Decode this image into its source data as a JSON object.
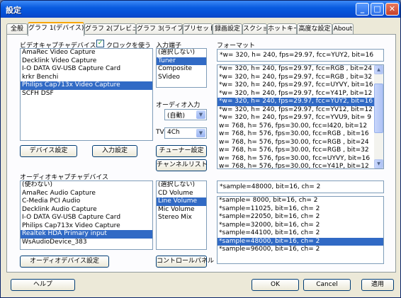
{
  "window": {
    "title": "設定",
    "min": "_",
    "max": "□",
    "close": "✕"
  },
  "tabs": [
    "全般",
    "グラフ 1(デバイス)",
    "グラフ 2(プレビュー)",
    "グラフ 3(ライブ)",
    "プリセット",
    "録画設定",
    "スクショ",
    "ホットキー",
    "高度な設定",
    "About"
  ],
  "active_tab": "グラフ 1(デバイス)",
  "video": {
    "label": "ビデオキャプチャデバイス",
    "clock_label": "クロックを使う",
    "clock_checked": "✓",
    "devices": [
      "AmaRec Video Capture",
      "Decklink Video Capture",
      "I-O DATA GV-USB Capture Card",
      "krkr Benchi",
      "Philips Cap713x Video Capture",
      "SCFH DSF"
    ],
    "selected": "Philips Cap713x Video Capture",
    "device_settings_btn": "デバイス設定",
    "input_settings_btn": "入力設定"
  },
  "input": {
    "label": "入力端子",
    "items": [
      "(選択しない)",
      "Tuner",
      "Composite",
      "SVideo"
    ],
    "selected": "Tuner",
    "audio_input_label": "オーディオ入力",
    "audio_input_value": "(自動)",
    "tv_label": "TV",
    "tv_value": "4Ch",
    "tuner_btn": "チューナー設定",
    "channel_btn": "チャンネルリスト"
  },
  "format": {
    "label": "フォーマット",
    "current": "*w= 320, h= 240, fps=29.97,  fcc=YUY2, bit=16",
    "items": [
      "*w= 320, h= 240, fps=29.97,  fcc=RGB , bit=24",
      "*w= 320, h= 240, fps=29.97,  fcc=RGB , bit=32",
      "*w= 320, h= 240, fps=29.97,  fcc=UYVY, bit=16",
      "*w= 320, h= 240, fps=29.97,  fcc=Y41P, bit=12",
      "*w= 320, h= 240, fps=29.97,  fcc=YUY2, bit=16",
      "*w= 320, h= 240, fps=29.97,  fcc=YV12, bit=12",
      "*w= 320, h= 240, fps=29.97,  fcc=YVU9, bit= 9",
      " w= 768, h= 576, fps=30.00,  fcc=I420, bit=12",
      " w= 768, h= 576, fps=30.00,  fcc=RGB , bit=16",
      " w= 768, h= 576, fps=30.00,  fcc=RGB , bit=24",
      " w= 768, h= 576, fps=30.00,  fcc=RGB , bit=32",
      " w= 768, h= 576, fps=30.00,  fcc=UYVY, bit=16",
      " w= 768, h= 576, fps=30.00,  fcc=Y41P, bit=12"
    ],
    "selected": "*w= 320, h= 240, fps=29.97,  fcc=YUY2, bit=16"
  },
  "audio": {
    "label": "オーディオキャプチャデバイス",
    "devices": [
      "(使わない)",
      "AmaRec Audio Capture",
      "C-Media PCI Audio",
      "Decklink Audio Capture",
      "I-O DATA GV-USB Capture Card",
      "Philips Cap713x Video Capture",
      "Realtek HDA Primary input",
      "WsAudioDevice_383"
    ],
    "selected": "Realtek HDA Primary input",
    "settings_btn": "オーディオデバイス設定",
    "inputs": [
      "(選択しない)",
      "CD Volume",
      "Line Volume",
      "Mic Volume",
      "Stereo Mix"
    ],
    "input_selected": "Line Volume",
    "control_panel_btn": "コントロールパネル",
    "format_current": "*sample=48000, bit=16, ch= 2",
    "formats": [
      "*sample= 8000, bit=16, ch= 2",
      "*sample=11025, bit=16, ch= 2",
      "*sample=22050, bit=16, ch= 2",
      "*sample=32000, bit=16, ch= 2",
      "*sample=44100, bit=16, ch= 2",
      "*sample=48000, bit=16, ch= 2",
      "*sample=96000, bit=16, ch= 2"
    ],
    "format_selected": "*sample=48000, bit=16, ch= 2"
  },
  "footer": {
    "help": "ヘルプ",
    "ok": "OK",
    "cancel": "Cancel",
    "apply": "適用"
  }
}
